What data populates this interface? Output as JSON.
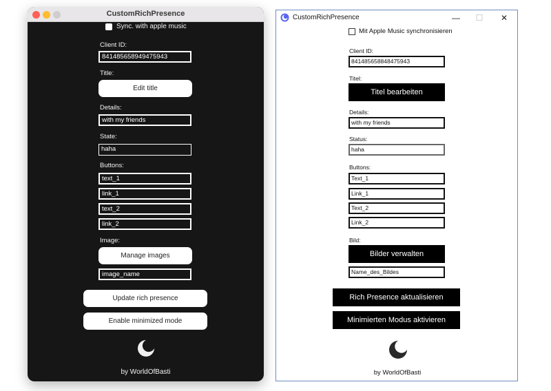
{
  "mac_window": {
    "title": "CustomRichPresence",
    "sync_label": "Sync. with apple music",
    "client_id_label": "Client ID:",
    "client_id_value": "841485658949475943",
    "title_label": "Title:",
    "edit_title_button": "Edit title",
    "details_label": "Details:",
    "details_value": "with my friends",
    "state_label": "State:",
    "state_value": "haha",
    "buttons_label": "Buttons:",
    "buttons": [
      "text_1",
      "link_1",
      "text_2",
      "link_2"
    ],
    "image_label": "Image:",
    "manage_images_button": "Manage images",
    "image_name_value": "image_name",
    "update_button": "Update rich presence",
    "minimized_button": "Enable minimized mode",
    "credit": "by WorldOfBasti"
  },
  "win_window": {
    "title": "CustomRichPresence",
    "minimize_glyph": "—",
    "maximize_glyph": "☐",
    "close_glyph": "✕",
    "sync_label": "Mit Apple Music synchronisieren",
    "client_id_label": "Client ID:",
    "client_id_value": "841485658848475943",
    "title_label": "Titel:",
    "edit_title_button": "Titel bearbeiten",
    "details_label": "Details:",
    "details_value": "with my friends",
    "state_label": "Status:",
    "state_value": "haha",
    "buttons_label": "Buttons:",
    "buttons": [
      "Text_1",
      "Link_1",
      "Text_2",
      "Link_2"
    ],
    "image_label": "Bild:",
    "manage_images_button": "Bilder verwalten",
    "image_name_value": "Name_des_Bildes",
    "update_button": "Rich Presence aktualisieren",
    "minimized_button": "Minimierten Modus aktivieren",
    "credit": "by WorldOfBasti"
  }
}
